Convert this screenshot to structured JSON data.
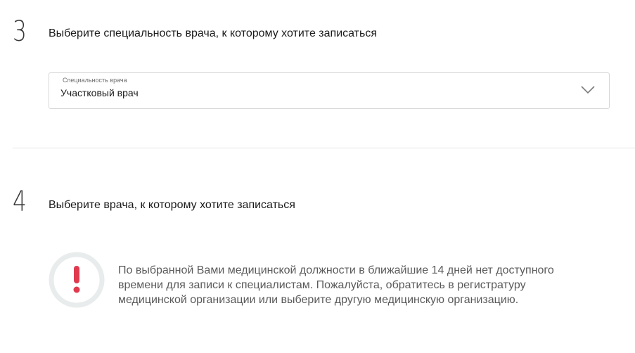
{
  "step3": {
    "number": "3",
    "title": "Выберите специальность врача, к которому хотите записаться",
    "select": {
      "label": "Специальность врача",
      "value": "Участковый врач"
    }
  },
  "step4": {
    "number": "4",
    "title": "Выберите врача, к которому хотите записаться",
    "alert": {
      "icon": "exclamation-icon",
      "icon_color": "#e03a4e",
      "message": "По выбранной Вами медицинской должности в ближайшие 14 дней нет доступного времени для записи к специалистам. Пожалуйста, обратитесь в регистратуру медицинской организации или выберите другую медицинскую организацию."
    }
  }
}
